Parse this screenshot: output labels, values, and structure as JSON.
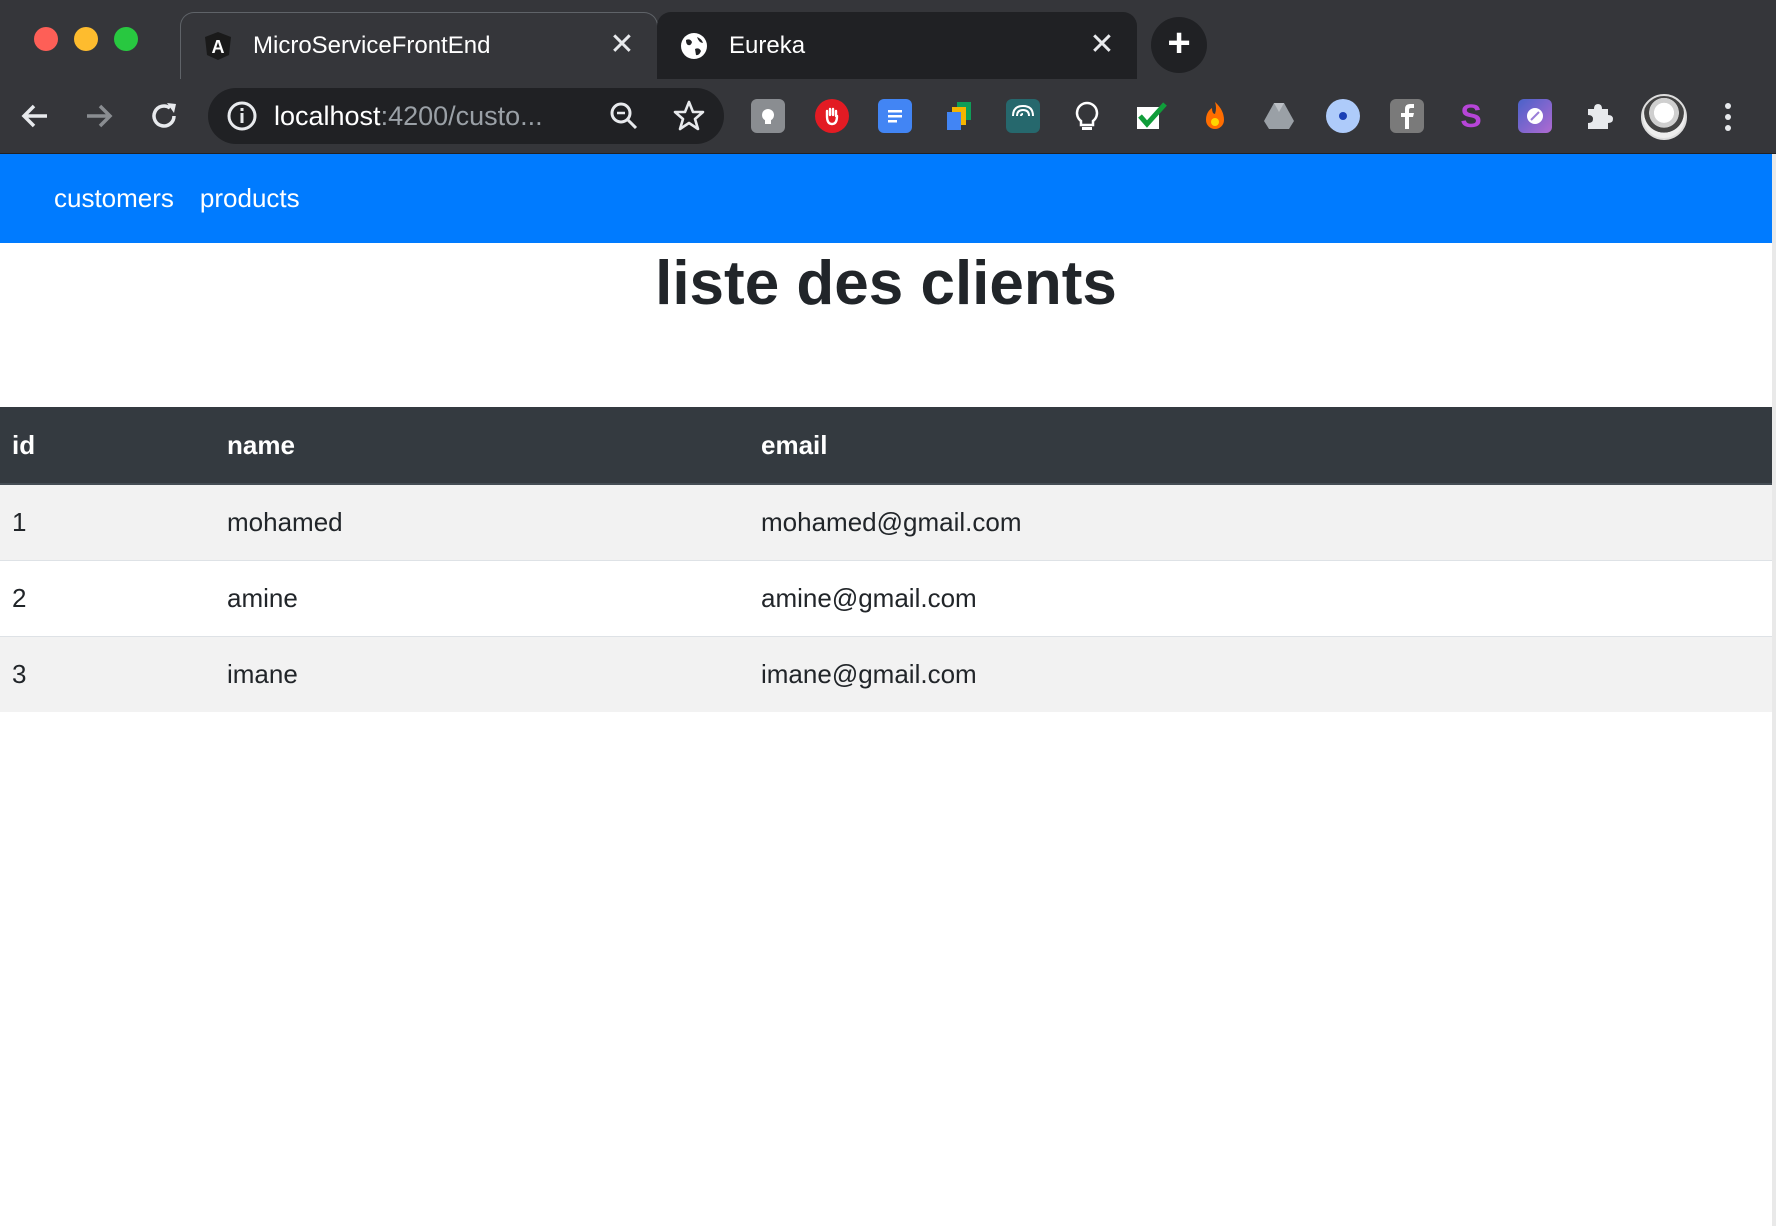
{
  "browser": {
    "tabs": [
      {
        "title": "MicroServiceFrontEnd",
        "favicon": "angular-icon",
        "active": true
      },
      {
        "title": "Eureka",
        "favicon": "globe-icon",
        "active": false
      }
    ],
    "new_tab_label": "+",
    "close_glyph": "✕",
    "url_host": "localhost",
    "url_rest": ":4200/custo...",
    "extensions": [
      "gray-extension-icon",
      "adblock-hand-icon",
      "google-docs-icon",
      "docs-stack-icon",
      "wave-extension-icon",
      "lightbulb-icon",
      "checkmark-extension-icon",
      "fire-extension-icon",
      "google-drive-icon",
      "blue-circle-extension-icon",
      "facebook-icon",
      "s-extension-icon",
      "purple-extension-icon",
      "puzzle-extensions-icon"
    ]
  },
  "navbar": {
    "links": [
      {
        "label": "customers"
      },
      {
        "label": "products"
      }
    ],
    "color": "#007bff"
  },
  "page": {
    "title": "liste des clients"
  },
  "table": {
    "headers": [
      "id",
      "name",
      "email"
    ],
    "rows": [
      [
        "1",
        "mohamed",
        "mohamed@gmail.com"
      ],
      [
        "2",
        "amine",
        "amine@gmail.com"
      ],
      [
        "3",
        "imane",
        "imane@gmail.com"
      ]
    ]
  }
}
